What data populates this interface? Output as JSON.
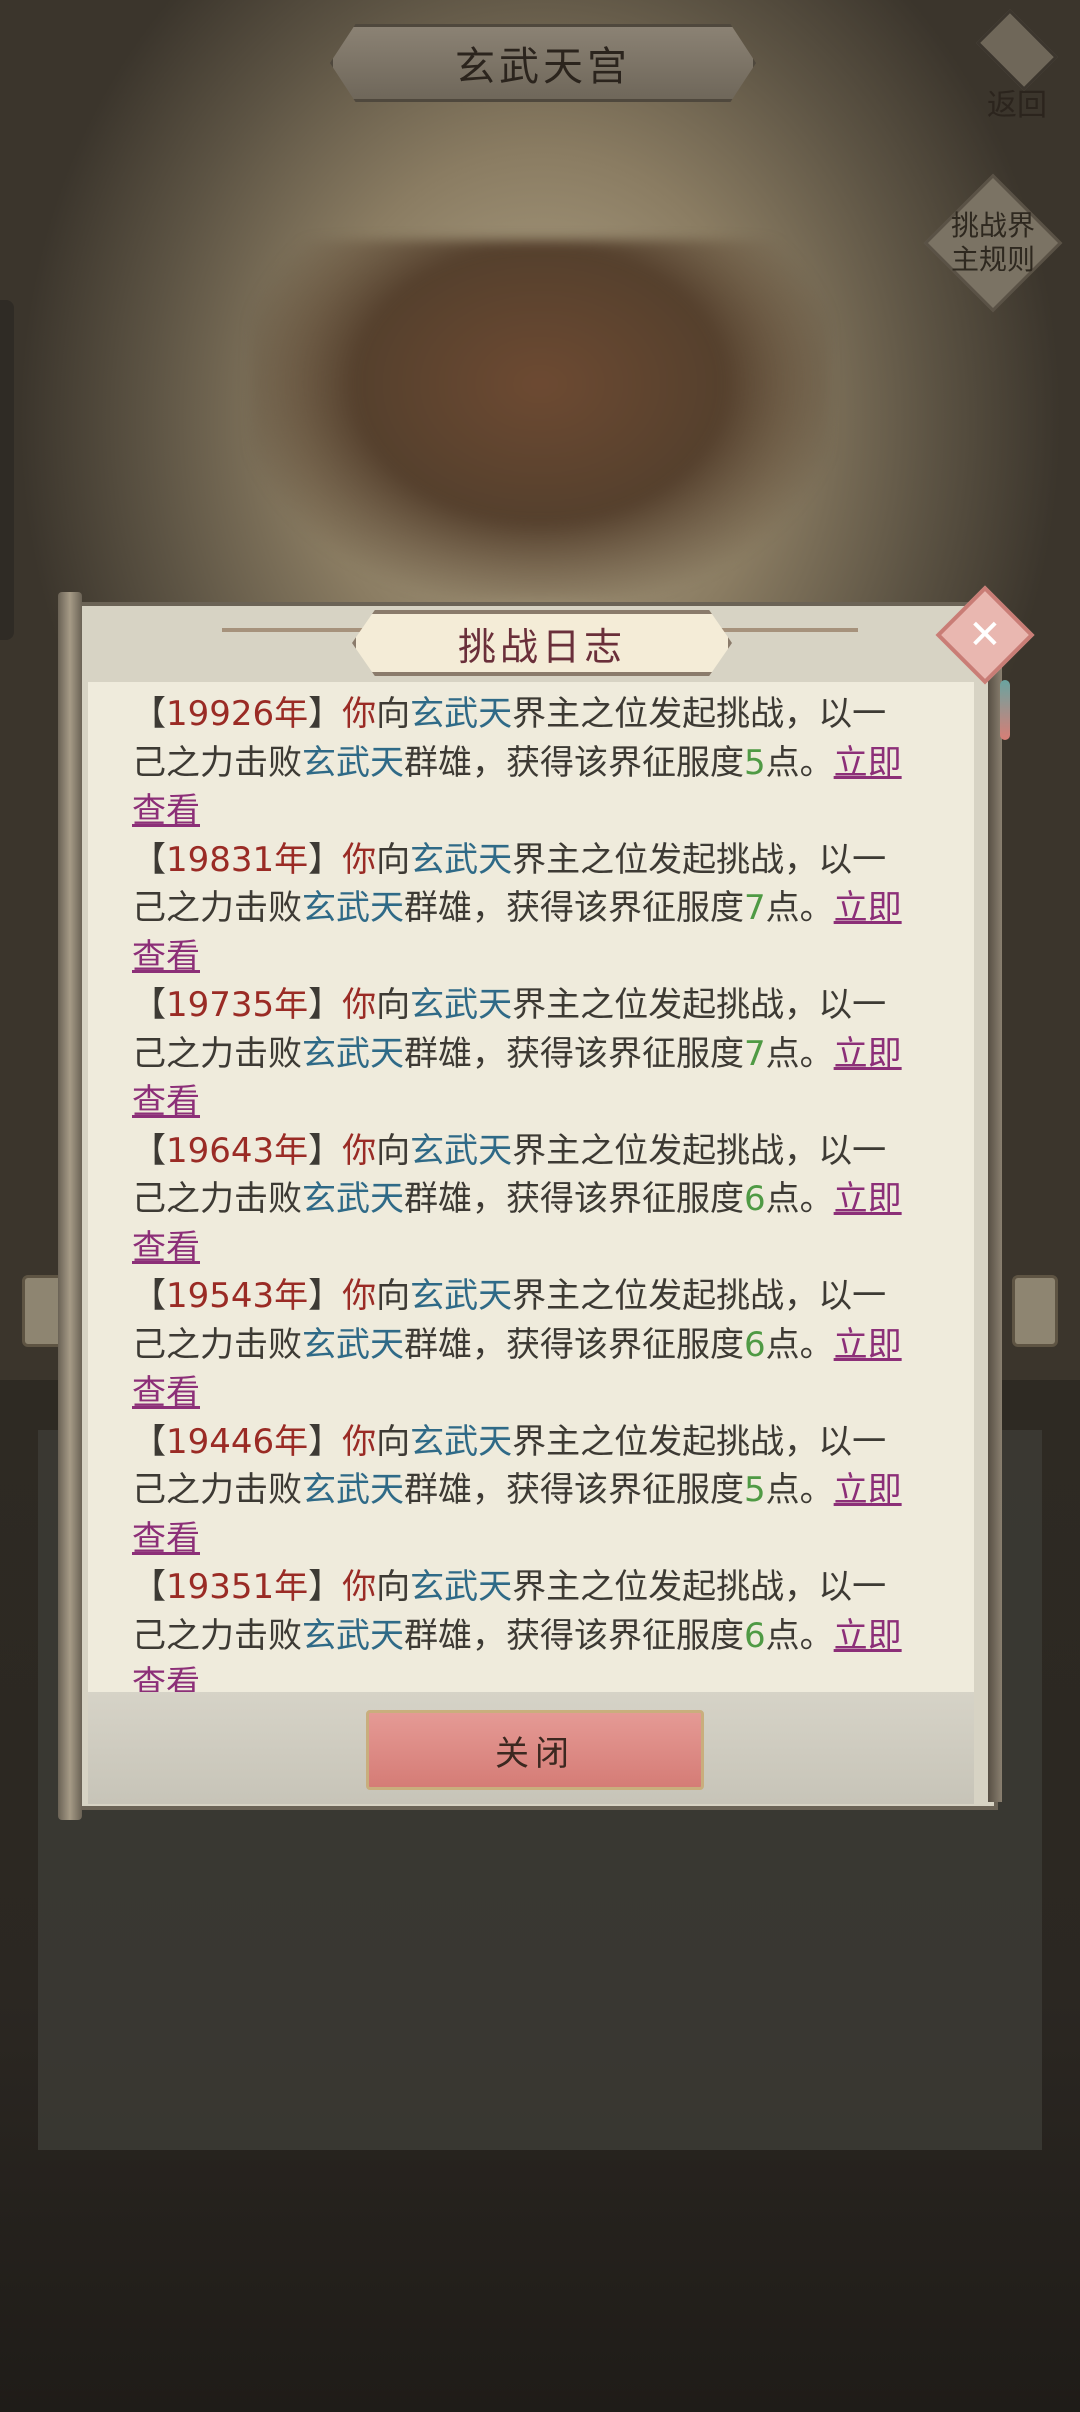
{
  "header": {
    "title": "玄武天宫",
    "back_label": "返回",
    "rules_label": "挑战界主规则"
  },
  "dialog": {
    "title": "挑战日志",
    "close_button_label": "关闭",
    "entries": [
      {
        "open": "【",
        "year": "19926年",
        "close": "】",
        "you": "你",
        "text1": "向",
        "realm1": "玄武天",
        "text2": "界主之位发起挑战，以一己之力击败",
        "realm2": "玄武天",
        "text3": "群雄，获得该界征服度",
        "points": "5",
        "text4": "点。",
        "link": "立即查看"
      },
      {
        "open": "【",
        "year": "19831年",
        "close": "】",
        "you": "你",
        "text1": "向",
        "realm1": "玄武天",
        "text2": "界主之位发起挑战，以一己之力击败",
        "realm2": "玄武天",
        "text3": "群雄，获得该界征服度",
        "points": "7",
        "text4": "点。",
        "link": "立即查看"
      },
      {
        "open": "【",
        "year": "19735年",
        "close": "】",
        "you": "你",
        "text1": "向",
        "realm1": "玄武天",
        "text2": "界主之位发起挑战，以一己之力击败",
        "realm2": "玄武天",
        "text3": "群雄，获得该界征服度",
        "points": "7",
        "text4": "点。",
        "link": "立即查看"
      },
      {
        "open": "【",
        "year": "19643年",
        "close": "】",
        "you": "你",
        "text1": "向",
        "realm1": "玄武天",
        "text2": "界主之位发起挑战，以一己之力击败",
        "realm2": "玄武天",
        "text3": "群雄，获得该界征服度",
        "points": "6",
        "text4": "点。",
        "link": "立即查看"
      },
      {
        "open": "【",
        "year": "19543年",
        "close": "】",
        "you": "你",
        "text1": "向",
        "realm1": "玄武天",
        "text2": "界主之位发起挑战，以一己之力击败",
        "realm2": "玄武天",
        "text3": "群雄，获得该界征服度",
        "points": "6",
        "text4": "点。",
        "link": "立即查看"
      },
      {
        "open": "【",
        "year": "19446年",
        "close": "】",
        "you": "你",
        "text1": "向",
        "realm1": "玄武天",
        "text2": "界主之位发起挑战，以一己之力击败",
        "realm2": "玄武天",
        "text3": "群雄，获得该界征服度",
        "points": "5",
        "text4": "点。",
        "link": "立即查看"
      },
      {
        "open": "【",
        "year": "19351年",
        "close": "】",
        "you": "你",
        "text1": "向",
        "realm1": "玄武天",
        "text2": "界主之位发起挑战，以一己之力击败",
        "realm2": "玄武天",
        "text3": "群雄，获得该界征服度",
        "points": "6",
        "text4": "点。",
        "link": "立即查看"
      }
    ]
  },
  "icons": {
    "close": "close-icon",
    "back": "back-arrow-icon"
  }
}
